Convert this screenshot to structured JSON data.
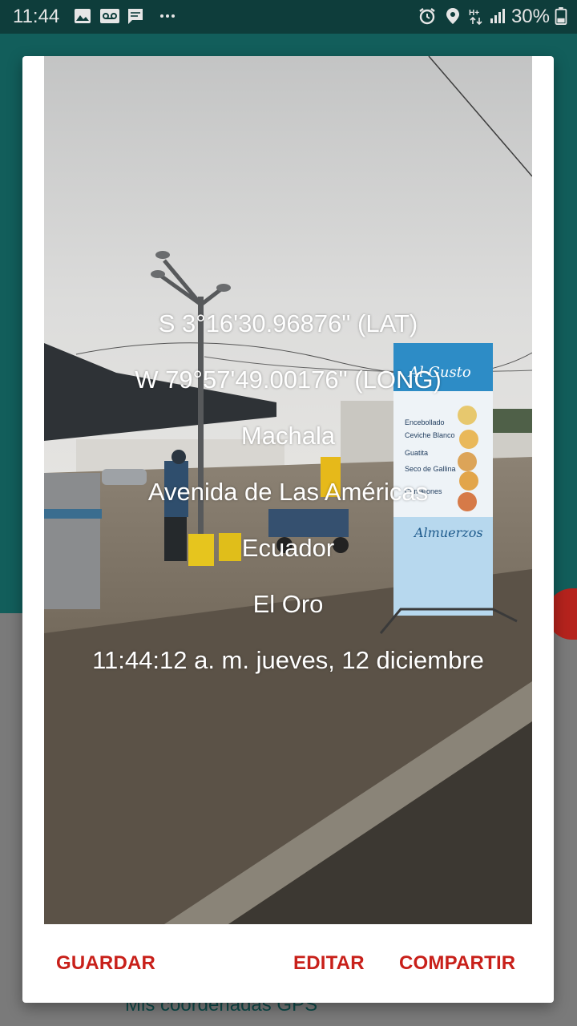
{
  "status_bar": {
    "time": "11:44",
    "battery": "30%",
    "icons": [
      "image-icon",
      "voicemail-icon",
      "message-icon",
      "more-icon",
      "alarm-icon",
      "location-icon",
      "network-hplus-icon",
      "signal-icon",
      "battery-icon"
    ]
  },
  "background_app": {
    "list_label": "Mis coordenadas GPS"
  },
  "dialog": {
    "photo_overlay": {
      "latitude": "S 3°16'30.96876\" (LAT)",
      "longitude": "W 79°57'49.00176\" (LONG)",
      "city": "Machala",
      "street": "Avenida de Las Américas",
      "country": "Ecuador",
      "province": "El Oro",
      "timestamp": "11:44:12 a. m. jueves, 12 diciembre"
    },
    "sign_text": {
      "brand": "Al Gusto",
      "items": [
        "Encebollado",
        "Ceviche Blanco",
        "Guatita",
        "Seco de Gallina",
        "Camarones"
      ],
      "footer": "Almuerzos"
    },
    "actions": {
      "save": "GUARDAR",
      "edit": "EDITAR",
      "share": "COMPARTIR"
    }
  },
  "colors": {
    "accent": "#c8201a",
    "app_primary": "#125e5b",
    "status_bar": "#0e3d3b"
  }
}
